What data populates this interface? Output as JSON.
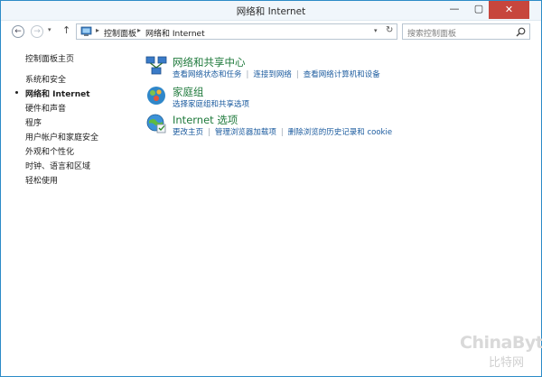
{
  "window": {
    "title": "网络和 Internet",
    "minimize_glyph": "—",
    "maximize_glyph": "▢",
    "close_glyph": "✕"
  },
  "nav": {
    "back_glyph": "←",
    "forward_glyph": "→",
    "recent_glyph": "▾",
    "up_glyph": "↑"
  },
  "address": {
    "segments": [
      "控制面板",
      "网络和 Internet"
    ],
    "separator": "▸",
    "dropdown_glyph": "▾",
    "refresh_glyph": "↻"
  },
  "search": {
    "placeholder": "搜索控制面板"
  },
  "sidebar": {
    "home": "控制面板主页",
    "items": [
      {
        "label": "系统和安全"
      },
      {
        "label": "网络和 Internet",
        "active": true
      },
      {
        "label": "硬件和声音"
      },
      {
        "label": "程序"
      },
      {
        "label": "用户帐户和家庭安全"
      },
      {
        "label": "外观和个性化"
      },
      {
        "label": "时钟、语言和区域"
      },
      {
        "label": "轻松使用"
      }
    ]
  },
  "categories": [
    {
      "title": "网络和共享中心",
      "icon": "network-sharing-center-icon",
      "links": [
        "查看网络状态和任务",
        "连接到网络",
        "查看网络计算机和设备"
      ]
    },
    {
      "title": "家庭组",
      "icon": "homegroup-icon",
      "links": [
        "选择家庭组和共享选项"
      ]
    },
    {
      "title": "Internet 选项",
      "icon": "internet-options-icon",
      "links": [
        "更改主页",
        "管理浏览器加载项",
        "删除浏览的历史记录和 cookie"
      ]
    }
  ],
  "watermark": {
    "brand": "ChinaByte",
    "sub": "比特网"
  },
  "colors": {
    "accent_border": "#2c8bc7",
    "close_button": "#c7463d",
    "category_title": "#1f7a3c",
    "link": "#1a5a9e"
  }
}
